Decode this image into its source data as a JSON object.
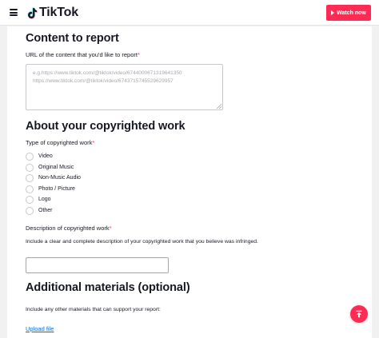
{
  "header": {
    "brand": "TikTok",
    "watch_now": "Watch now",
    "icons": {
      "menu": "hamburger-icon",
      "logo": "tiktok-note-icon",
      "play": "play-icon"
    }
  },
  "content_section": {
    "title": "Content to report",
    "url_label": "URL of the content that you'd like to report",
    "required_mark": "*",
    "url_placeholder_line1": "e.g.https://www.tiktok.com/@tiktok/video/6744000671319641350",
    "url_placeholder_line2": "https://www.tiktok.com/@tiktok/video/6743715745529629957"
  },
  "copyright_section": {
    "title": "About your copyrighted work",
    "type_label": "Type of copyrighted work",
    "required_mark": "*",
    "options": [
      "Video",
      "Original Music",
      "Non-Music Audio",
      "Photo / Picture",
      "Logo",
      "Other"
    ],
    "description_label": "Description of copyrighted work",
    "description_required_mark": "*",
    "description_help": "Include a clear and complete description of your copyrighted work that you believe was infringed.",
    "description_value": ""
  },
  "additional_section": {
    "title": "Additional materials (optional)",
    "help": "Include any other materials that can support your report:",
    "upload_link": "Upload file"
  },
  "fab": {
    "icon": "scroll-to-top-icon"
  },
  "colors": {
    "accent": "#fe2c55",
    "link": "#0b6bd8"
  }
}
